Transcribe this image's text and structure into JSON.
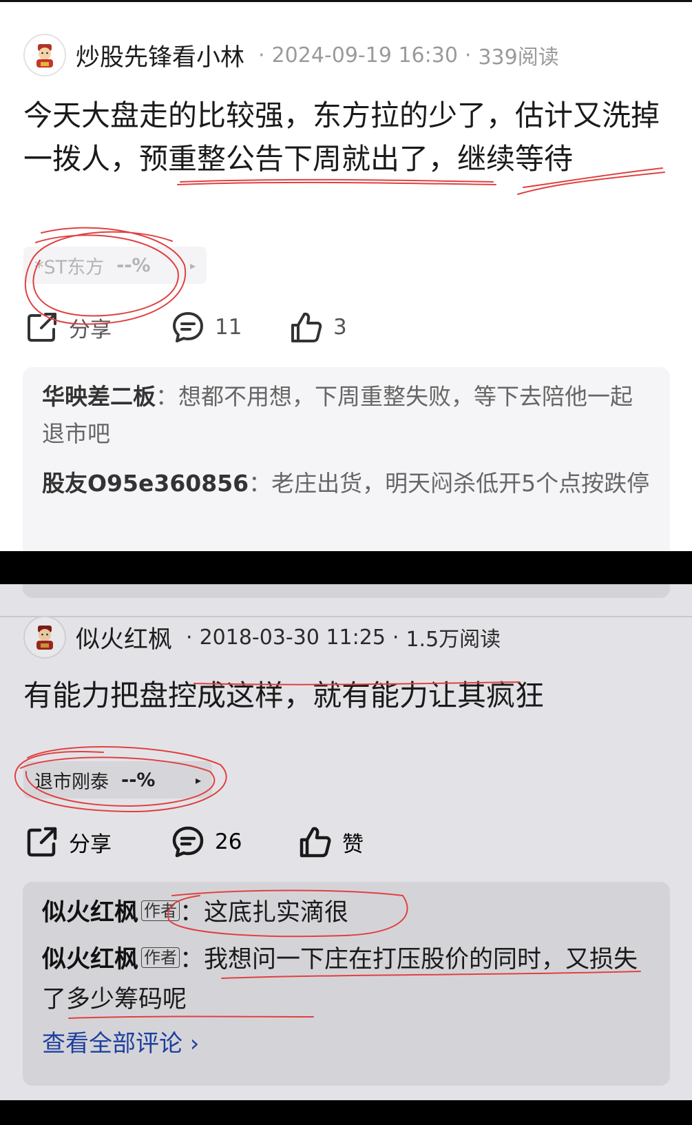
{
  "post1": {
    "author": "炒股先锋看小林",
    "date": "2024-09-19 16:30",
    "reads": "339阅读",
    "sep": "·",
    "content": "今天大盘走的比较强，东方拉的少了，估计又洗掉一拨人，预重整公告下周就出了，继续等待",
    "stock": {
      "name": "*ST东方",
      "change": "--%",
      "arrow": "▸"
    },
    "actions": {
      "share": "分享",
      "comments": "11",
      "likes": "3"
    },
    "comments": [
      {
        "user": "华映差二板",
        "sep": "：",
        "text": "想都不用想，下周重整失败，等下去陪他一起退市吧"
      },
      {
        "user": "股友O95e360856",
        "sep": "：",
        "text": "老庄出货，明天闷杀低开5个点按跌停"
      }
    ]
  },
  "post2": {
    "author": "似火红枫",
    "date": "2018-03-30 11:25",
    "reads": "1.5万阅读",
    "sep": "·",
    "content": "有能力把盘控成这样，就有能力让其疯狂",
    "stock": {
      "name": "退市刚泰",
      "change": "--%",
      "arrow": "▸"
    },
    "actions": {
      "share": "分享",
      "comments": "26",
      "likes": "赞"
    },
    "comments": [
      {
        "user": "似火红枫",
        "tag": "作者",
        "sep": "：",
        "text": "这底扎实滴很"
      },
      {
        "user": "似火红枫",
        "tag": "作者",
        "sep": "：",
        "text": "我想问一下庄在打压股价的同时，又损失了多少筹码呢"
      }
    ],
    "view_all": "查看全部评论 ›"
  },
  "colors": {
    "panel1_bg": "#ffffff",
    "panel2_bg": "#e3e3e7",
    "link_blue": "#1d3f9e",
    "annotation_red": "#e04040"
  },
  "icons": [
    "avatar-caishen-icon",
    "share-icon",
    "comment-icon",
    "thumbs-up-icon",
    "chevron-right-icon"
  ]
}
